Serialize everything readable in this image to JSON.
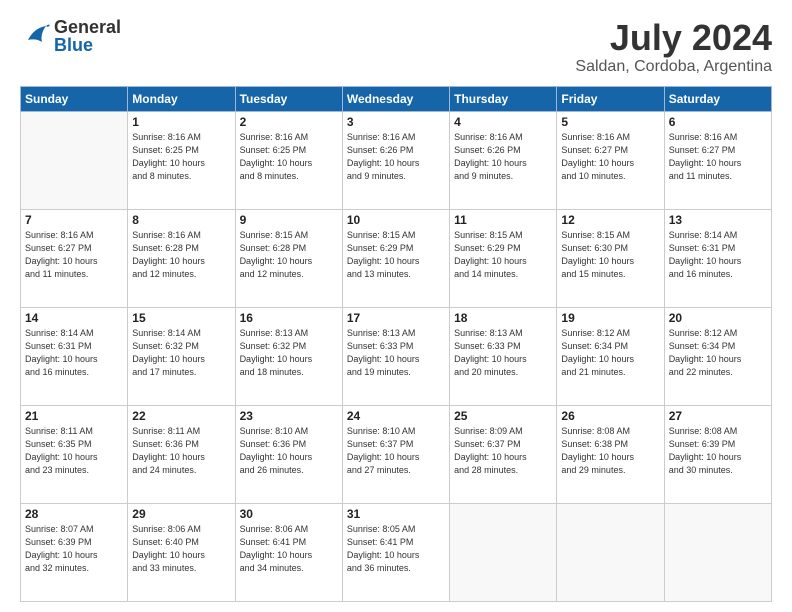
{
  "header": {
    "logo_general": "General",
    "logo_blue": "Blue",
    "month": "July 2024",
    "location": "Saldan, Cordoba, Argentina"
  },
  "weekdays": [
    "Sunday",
    "Monday",
    "Tuesday",
    "Wednesday",
    "Thursday",
    "Friday",
    "Saturday"
  ],
  "weeks": [
    [
      {
        "day": "",
        "info": ""
      },
      {
        "day": "1",
        "info": "Sunrise: 8:16 AM\nSunset: 6:25 PM\nDaylight: 10 hours\nand 8 minutes."
      },
      {
        "day": "2",
        "info": "Sunrise: 8:16 AM\nSunset: 6:25 PM\nDaylight: 10 hours\nand 8 minutes."
      },
      {
        "day": "3",
        "info": "Sunrise: 8:16 AM\nSunset: 6:26 PM\nDaylight: 10 hours\nand 9 minutes."
      },
      {
        "day": "4",
        "info": "Sunrise: 8:16 AM\nSunset: 6:26 PM\nDaylight: 10 hours\nand 9 minutes."
      },
      {
        "day": "5",
        "info": "Sunrise: 8:16 AM\nSunset: 6:27 PM\nDaylight: 10 hours\nand 10 minutes."
      },
      {
        "day": "6",
        "info": "Sunrise: 8:16 AM\nSunset: 6:27 PM\nDaylight: 10 hours\nand 11 minutes."
      }
    ],
    [
      {
        "day": "7",
        "info": "Sunrise: 8:16 AM\nSunset: 6:27 PM\nDaylight: 10 hours\nand 11 minutes."
      },
      {
        "day": "8",
        "info": "Sunrise: 8:16 AM\nSunset: 6:28 PM\nDaylight: 10 hours\nand 12 minutes."
      },
      {
        "day": "9",
        "info": "Sunrise: 8:15 AM\nSunset: 6:28 PM\nDaylight: 10 hours\nand 12 minutes."
      },
      {
        "day": "10",
        "info": "Sunrise: 8:15 AM\nSunset: 6:29 PM\nDaylight: 10 hours\nand 13 minutes."
      },
      {
        "day": "11",
        "info": "Sunrise: 8:15 AM\nSunset: 6:29 PM\nDaylight: 10 hours\nand 14 minutes."
      },
      {
        "day": "12",
        "info": "Sunrise: 8:15 AM\nSunset: 6:30 PM\nDaylight: 10 hours\nand 15 minutes."
      },
      {
        "day": "13",
        "info": "Sunrise: 8:14 AM\nSunset: 6:31 PM\nDaylight: 10 hours\nand 16 minutes."
      }
    ],
    [
      {
        "day": "14",
        "info": "Sunrise: 8:14 AM\nSunset: 6:31 PM\nDaylight: 10 hours\nand 16 minutes."
      },
      {
        "day": "15",
        "info": "Sunrise: 8:14 AM\nSunset: 6:32 PM\nDaylight: 10 hours\nand 17 minutes."
      },
      {
        "day": "16",
        "info": "Sunrise: 8:13 AM\nSunset: 6:32 PM\nDaylight: 10 hours\nand 18 minutes."
      },
      {
        "day": "17",
        "info": "Sunrise: 8:13 AM\nSunset: 6:33 PM\nDaylight: 10 hours\nand 19 minutes."
      },
      {
        "day": "18",
        "info": "Sunrise: 8:13 AM\nSunset: 6:33 PM\nDaylight: 10 hours\nand 20 minutes."
      },
      {
        "day": "19",
        "info": "Sunrise: 8:12 AM\nSunset: 6:34 PM\nDaylight: 10 hours\nand 21 minutes."
      },
      {
        "day": "20",
        "info": "Sunrise: 8:12 AM\nSunset: 6:34 PM\nDaylight: 10 hours\nand 22 minutes."
      }
    ],
    [
      {
        "day": "21",
        "info": "Sunrise: 8:11 AM\nSunset: 6:35 PM\nDaylight: 10 hours\nand 23 minutes."
      },
      {
        "day": "22",
        "info": "Sunrise: 8:11 AM\nSunset: 6:36 PM\nDaylight: 10 hours\nand 24 minutes."
      },
      {
        "day": "23",
        "info": "Sunrise: 8:10 AM\nSunset: 6:36 PM\nDaylight: 10 hours\nand 26 minutes."
      },
      {
        "day": "24",
        "info": "Sunrise: 8:10 AM\nSunset: 6:37 PM\nDaylight: 10 hours\nand 27 minutes."
      },
      {
        "day": "25",
        "info": "Sunrise: 8:09 AM\nSunset: 6:37 PM\nDaylight: 10 hours\nand 28 minutes."
      },
      {
        "day": "26",
        "info": "Sunrise: 8:08 AM\nSunset: 6:38 PM\nDaylight: 10 hours\nand 29 minutes."
      },
      {
        "day": "27",
        "info": "Sunrise: 8:08 AM\nSunset: 6:39 PM\nDaylight: 10 hours\nand 30 minutes."
      }
    ],
    [
      {
        "day": "28",
        "info": "Sunrise: 8:07 AM\nSunset: 6:39 PM\nDaylight: 10 hours\nand 32 minutes."
      },
      {
        "day": "29",
        "info": "Sunrise: 8:06 AM\nSunset: 6:40 PM\nDaylight: 10 hours\nand 33 minutes."
      },
      {
        "day": "30",
        "info": "Sunrise: 8:06 AM\nSunset: 6:41 PM\nDaylight: 10 hours\nand 34 minutes."
      },
      {
        "day": "31",
        "info": "Sunrise: 8:05 AM\nSunset: 6:41 PM\nDaylight: 10 hours\nand 36 minutes."
      },
      {
        "day": "",
        "info": ""
      },
      {
        "day": "",
        "info": ""
      },
      {
        "day": "",
        "info": ""
      }
    ]
  ]
}
